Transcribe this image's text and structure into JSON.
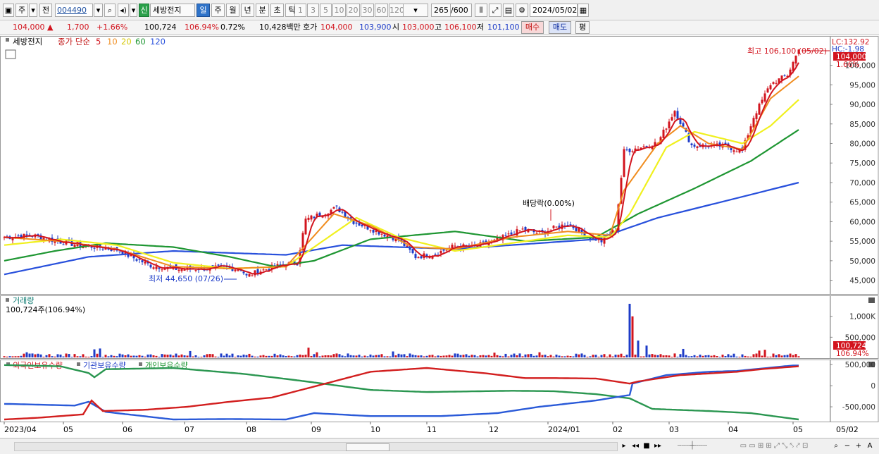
{
  "toolbar": {
    "market": "주",
    "prev": "전",
    "code": "004490",
    "name_badge": "신",
    "name": "세방전지",
    "periods": [
      "일",
      "주",
      "월",
      "년",
      "분",
      "초",
      "틱"
    ],
    "active_period": "일",
    "intervals": [
      "1",
      "3",
      "5",
      "10",
      "20",
      "30",
      "60",
      "120"
    ],
    "count": "265",
    "count_total": "/600",
    "date": "2024/05/02"
  },
  "infobar": {
    "price": "104,000 ▲",
    "change": "1,700",
    "change_pct": "+1.66%",
    "volume": "100,724",
    "vol_ratio": "106.94%",
    "turnover": "0.72%",
    "amount": "10,428백만",
    "quote_label": "호가",
    "ask": "104,000",
    "bid": "103,900",
    "open_label": "시",
    "open": "103,000",
    "high_label": "고",
    "high": "106,100",
    "low_label": "저",
    "low": "101,100",
    "buy": "매수",
    "sell": "매도",
    "avg": "평"
  },
  "colors": {
    "up": "#d2141e",
    "down": "#1e3cc8",
    "ma5": "#d2141e",
    "ma10": "#f08c1e",
    "ma20": "#f0f01e",
    "ma60": "#1e9632",
    "ma120": "#2850dc"
  },
  "chart_data": [
    {
      "type": "candlestick",
      "legend": [
        "세방전지",
        "종가 단순",
        "5",
        "10",
        "20",
        "60",
        "120"
      ],
      "annotations": {
        "high": "최고 106,100 (05/02)",
        "low": "최저 44,650 (07/26)",
        "dividend": "배당락(0.00%)",
        "lc": "LC:132.92",
        "hc": "HC:-1.98",
        "last_price": "104,000",
        "last_pct": "1.66%"
      },
      "yticks": [
        45000,
        50000,
        55000,
        60000,
        65000,
        70000,
        75000,
        80000,
        85000,
        90000,
        95000,
        100000
      ],
      "ytick_labels": [
        "45,000",
        "50,000",
        "55,000",
        "60,000",
        "65,000",
        "70,000",
        "75,000",
        "80,000",
        "85,000",
        "90,000",
        "95,000",
        "100,000"
      ],
      "ylim": [
        41500,
        107500
      ],
      "close_anchors": [
        [
          0,
          56000
        ],
        [
          10,
          56500
        ],
        [
          22,
          54500
        ],
        [
          40,
          52800
        ],
        [
          45,
          51000
        ],
        [
          52,
          48800
        ],
        [
          62,
          47800
        ],
        [
          78,
          48200
        ],
        [
          84,
          47900
        ],
        [
          86,
          46000
        ],
        [
          90,
          47200
        ],
        [
          96,
          48500
        ],
        [
          104,
          49500
        ],
        [
          107,
          60500
        ],
        [
          118,
          63500
        ],
        [
          124,
          60000
        ],
        [
          134,
          57000
        ],
        [
          140,
          55500
        ],
        [
          146,
          51000
        ],
        [
          153,
          51800
        ],
        [
          160,
          53800
        ],
        [
          166,
          53500
        ],
        [
          174,
          55000
        ],
        [
          184,
          58000
        ],
        [
          190,
          57000
        ],
        [
          200,
          59500
        ],
        [
          208,
          56000
        ],
        [
          212,
          55000
        ],
        [
          217,
          58000
        ],
        [
          220,
          78000
        ],
        [
          232,
          80200
        ],
        [
          238,
          88500
        ],
        [
          244,
          79500
        ],
        [
          256,
          79300
        ],
        [
          262,
          78000
        ],
        [
          266,
          86800
        ],
        [
          272,
          95200
        ],
        [
          278,
          97500
        ],
        [
          282,
          104000
        ]
      ],
      "ma_anchors": {
        "ma10": [
          [
            0,
            56000
          ],
          [
            20,
            55000
          ],
          [
            40,
            53000
          ],
          [
            60,
            48500
          ],
          [
            80,
            48000
          ],
          [
            100,
            48500
          ],
          [
            107,
            54000
          ],
          [
            117,
            62000
          ],
          [
            130,
            59000
          ],
          [
            145,
            53500
          ],
          [
            160,
            53000
          ],
          [
            180,
            56000
          ],
          [
            200,
            57500
          ],
          [
            215,
            56500
          ],
          [
            220,
            68000
          ],
          [
            232,
            80000
          ],
          [
            240,
            84500
          ],
          [
            250,
            80000
          ],
          [
            262,
            78500
          ],
          [
            272,
            91500
          ],
          [
            282,
            97200
          ]
        ],
        "ma20": [
          [
            0,
            54000
          ],
          [
            20,
            55500
          ],
          [
            40,
            54000
          ],
          [
            60,
            49500
          ],
          [
            80,
            48000
          ],
          [
            100,
            48500
          ],
          [
            107,
            52000
          ],
          [
            125,
            61000
          ],
          [
            140,
            56000
          ],
          [
            160,
            52500
          ],
          [
            180,
            54500
          ],
          [
            200,
            56500
          ],
          [
            215,
            56000
          ],
          [
            222,
            62000
          ],
          [
            235,
            79000
          ],
          [
            245,
            83000
          ],
          [
            262,
            80000
          ],
          [
            272,
            84500
          ],
          [
            282,
            91200
          ]
        ],
        "ma60": [
          [
            0,
            50000
          ],
          [
            18,
            52500
          ],
          [
            36,
            54500
          ],
          [
            60,
            53500
          ],
          [
            80,
            51000
          ],
          [
            96,
            48500
          ],
          [
            110,
            50000
          ],
          [
            130,
            55500
          ],
          [
            160,
            57500
          ],
          [
            185,
            55000
          ],
          [
            210,
            56000
          ],
          [
            225,
            62000
          ],
          [
            245,
            68500
          ],
          [
            265,
            75500
          ],
          [
            282,
            83500
          ]
        ],
        "ma120": [
          [
            0,
            46500
          ],
          [
            30,
            51000
          ],
          [
            60,
            52500
          ],
          [
            100,
            51500
          ],
          [
            120,
            54000
          ],
          [
            160,
            53000
          ],
          [
            210,
            55500
          ],
          [
            232,
            61000
          ],
          [
            260,
            66000
          ],
          [
            282,
            70000
          ]
        ]
      }
    },
    {
      "type": "bar",
      "title": "거래량",
      "value_label": "100,724주(106.94%)",
      "yticks": [
        500000,
        1000000
      ],
      "ytick_labels": [
        "500,000",
        "1,000K"
      ],
      "ylim": [
        0,
        1400000
      ],
      "last_value": "100,724",
      "last_pct": "106.94%",
      "spikes": [
        [
          8,
          140000
        ],
        [
          32,
          210000
        ],
        [
          34,
          230000
        ],
        [
          66,
          170000
        ],
        [
          108,
          250000
        ],
        [
          111,
          140000
        ],
        [
          138,
          160000
        ],
        [
          174,
          130000
        ],
        [
          190,
          140000
        ],
        [
          222,
          1300000
        ],
        [
          223,
          1000000
        ],
        [
          225,
          420000
        ],
        [
          228,
          300000
        ],
        [
          241,
          220000
        ],
        [
          268,
          180000
        ],
        [
          270,
          200000
        ]
      ],
      "base": 80000
    },
    {
      "type": "line",
      "series_labels": [
        "외국인보유수량",
        "기관보유수량",
        "개인보유수량"
      ],
      "yticks": [
        -500000,
        0,
        500000
      ],
      "ytick_labels": [
        "-500,000",
        "0",
        "500,000"
      ],
      "ylim": [
        -850000,
        620000
      ],
      "foreign": [
        [
          0,
          -800000
        ],
        [
          12,
          -760000
        ],
        [
          28,
          -680000
        ],
        [
          31,
          -350000
        ],
        [
          35,
          -600000
        ],
        [
          50,
          -570000
        ],
        [
          65,
          -500000
        ],
        [
          80,
          -380000
        ],
        [
          95,
          -280000
        ],
        [
          110,
          -20000
        ],
        [
          130,
          330000
        ],
        [
          150,
          420000
        ],
        [
          170,
          300000
        ],
        [
          185,
          180000
        ],
        [
          196,
          180000
        ],
        [
          210,
          170000
        ],
        [
          222,
          50000
        ],
        [
          225,
          100000
        ],
        [
          240,
          250000
        ],
        [
          260,
          330000
        ],
        [
          270,
          400000
        ],
        [
          282,
          460000
        ]
      ],
      "institution": [
        [
          0,
          -430000
        ],
        [
          25,
          -470000
        ],
        [
          30,
          -380000
        ],
        [
          36,
          -620000
        ],
        [
          60,
          -800000
        ],
        [
          80,
          -790000
        ],
        [
          100,
          -800000
        ],
        [
          110,
          -650000
        ],
        [
          130,
          -720000
        ],
        [
          155,
          -720000
        ],
        [
          175,
          -650000
        ],
        [
          190,
          -500000
        ],
        [
          210,
          -350000
        ],
        [
          222,
          -220000
        ],
        [
          223,
          50000
        ],
        [
          235,
          250000
        ],
        [
          250,
          330000
        ],
        [
          260,
          350000
        ],
        [
          280,
          480000
        ]
      ],
      "individual": [
        [
          0,
          490000
        ],
        [
          20,
          460000
        ],
        [
          30,
          300000
        ],
        [
          32,
          200000
        ],
        [
          36,
          390000
        ],
        [
          60,
          420000
        ],
        [
          85,
          280000
        ],
        [
          105,
          120000
        ],
        [
          130,
          -100000
        ],
        [
          150,
          -150000
        ],
        [
          180,
          -120000
        ],
        [
          195,
          -130000
        ],
        [
          210,
          -200000
        ],
        [
          222,
          -300000
        ],
        [
          230,
          -550000
        ],
        [
          250,
          -600000
        ],
        [
          265,
          -650000
        ],
        [
          282,
          -800000
        ]
      ]
    }
  ],
  "xaxis": {
    "ticks": [
      {
        "label": "2023/04",
        "i": 0
      },
      {
        "label": "05",
        "i": 21
      },
      {
        "label": "06",
        "i": 42
      },
      {
        "label": "07",
        "i": 64
      },
      {
        "label": "08",
        "i": 86
      },
      {
        "label": "09",
        "i": 109
      },
      {
        "label": "10",
        "i": 130
      },
      {
        "label": "11",
        "i": 150
      },
      {
        "label": "12",
        "i": 172
      },
      {
        "label": "2024/01",
        "i": 193
      },
      {
        "label": "02",
        "i": 216
      },
      {
        "label": "03",
        "i": 236
      },
      {
        "label": "04",
        "i": 257
      },
      {
        "label": "05",
        "i": 280
      }
    ],
    "last_label": "05/02"
  }
}
